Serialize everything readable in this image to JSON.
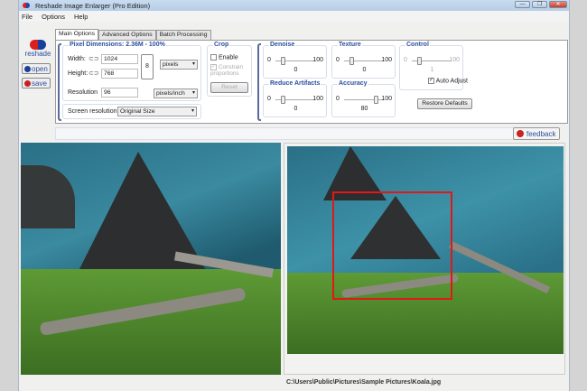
{
  "window": {
    "title": "Reshade Image Enlarger (Pro Edition)",
    "min": "—",
    "max": "❐",
    "close": "✕"
  },
  "menu": [
    "File",
    "Options",
    "Help"
  ],
  "logo": {
    "text": "reshade",
    "open": "open",
    "save": "save"
  },
  "tabs": [
    "Main Options",
    "Advanced Options",
    "Batch Processing"
  ],
  "pixel_dimensions": {
    "label": "Pixel Dimensions: 2.36M - 100%",
    "width_label": "Width:",
    "width": "1024",
    "height_label": "Height:",
    "height": "768",
    "unit": "pixels",
    "resolution_label": "Resolution",
    "resolution": "96",
    "res_unit": "pixels/inch"
  },
  "screen_resolution": {
    "label": "Screen resolution",
    "value": "Original Size"
  },
  "crop": {
    "label": "Crop",
    "enable": "Enable",
    "constrain": "Constrain proportions",
    "reset": "Reset"
  },
  "sliders": {
    "denoise": {
      "label": "Denoise",
      "min": "0",
      "max": "100",
      "value": "0",
      "v": 0
    },
    "texture": {
      "label": "Texture",
      "min": "0",
      "max": "100",
      "value": "0",
      "v": 0
    },
    "control": {
      "label": "Control",
      "min": "0",
      "max": "100",
      "value": "1",
      "v": 1
    },
    "reduce": {
      "label": "Reduce Artifacts",
      "min": "0",
      "max": "100",
      "value": "0",
      "v": 0
    },
    "accuracy": {
      "label": "Accuracy",
      "min": "0",
      "max": "100",
      "value": "80",
      "v": 80
    }
  },
  "auto_adjust": "Auto Adjust",
  "restore": "Restore Defaults",
  "feedback": "feedback",
  "status_path": "C:\\Users\\Public\\Pictures\\Sample Pictures\\Koala.jpg"
}
